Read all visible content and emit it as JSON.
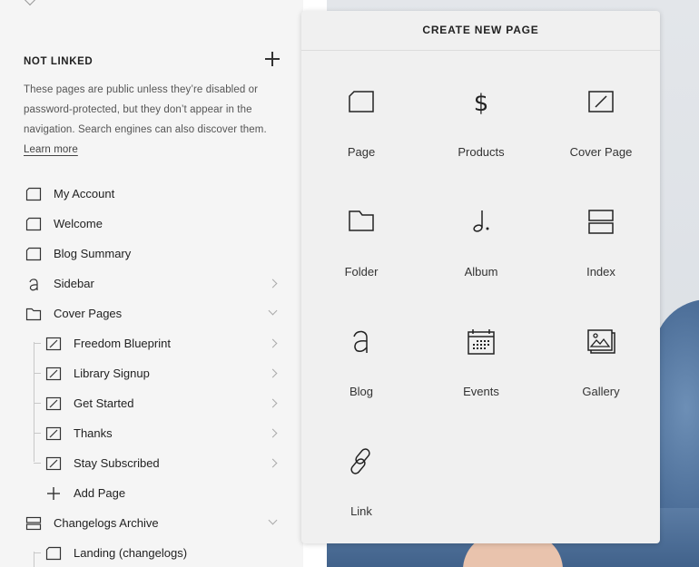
{
  "sidebar": {
    "section_title": "NOT LINKED",
    "description": "These pages are public unless they’re disabled or password-protected, but they don’t appear in the navigation. Search engines can also discover them.",
    "learn_more": "Learn more",
    "items": [
      {
        "label": "My Account",
        "icon": "page-icon"
      },
      {
        "label": "Welcome",
        "icon": "page-icon"
      },
      {
        "label": "Blog Summary",
        "icon": "page-icon"
      },
      {
        "label": "Sidebar",
        "icon": "blog-icon"
      },
      {
        "label": "Cover Pages",
        "icon": "folder-icon"
      },
      {
        "label": "Freedom Blueprint",
        "icon": "cover-page-icon"
      },
      {
        "label": "Library Signup",
        "icon": "cover-page-icon"
      },
      {
        "label": "Get Started",
        "icon": "cover-page-icon"
      },
      {
        "label": "Thanks",
        "icon": "cover-page-icon"
      },
      {
        "label": "Stay Subscribed",
        "icon": "cover-page-icon"
      },
      {
        "label": "Add Page",
        "icon": "plus-icon"
      },
      {
        "label": "Changelogs Archive",
        "icon": "index-icon"
      },
      {
        "label": "Landing (changelogs)",
        "icon": "page-icon"
      }
    ]
  },
  "panel": {
    "title": "CREATE NEW PAGE",
    "tiles": [
      {
        "label": "Page",
        "icon": "page-icon"
      },
      {
        "label": "Products",
        "icon": "dollar-icon"
      },
      {
        "label": "Cover Page",
        "icon": "cover-page-icon"
      },
      {
        "label": "Folder",
        "icon": "folder-icon"
      },
      {
        "label": "Album",
        "icon": "music-note-icon"
      },
      {
        "label": "Index",
        "icon": "index-icon"
      },
      {
        "label": "Blog",
        "icon": "blog-icon"
      },
      {
        "label": "Events",
        "icon": "calendar-icon"
      },
      {
        "label": "Gallery",
        "icon": "gallery-icon"
      },
      {
        "label": "Link",
        "icon": "link-icon"
      }
    ]
  }
}
